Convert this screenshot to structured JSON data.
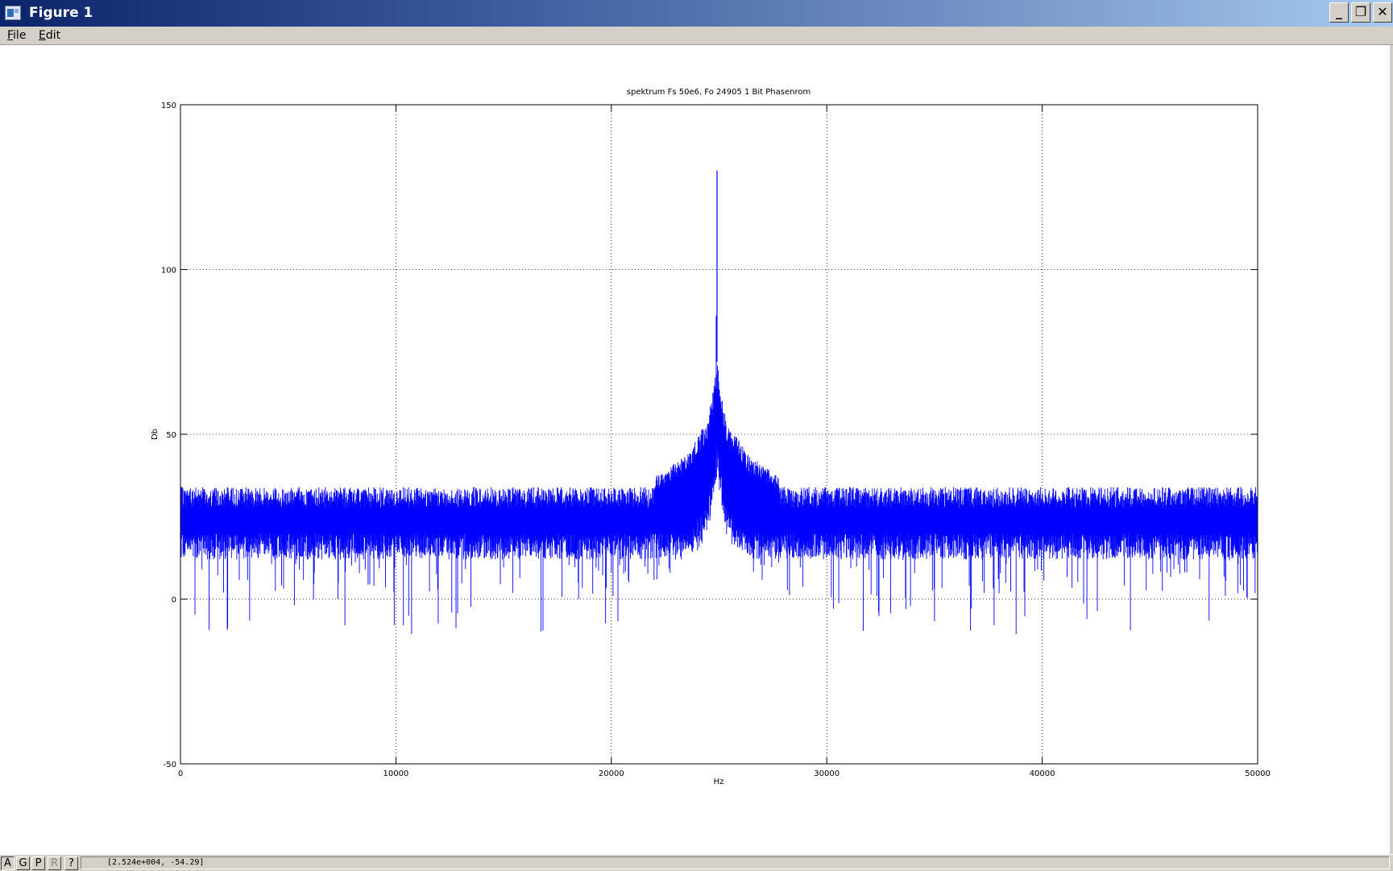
{
  "window": {
    "title": "Figure 1",
    "minimize_symbol": "_",
    "maximize_symbol": "❐",
    "close_symbol": "✕"
  },
  "menu": {
    "items": [
      {
        "label": "File",
        "accel": "F",
        "rest": "ile"
      },
      {
        "label": "Edit",
        "accel": "E",
        "rest": "dit"
      }
    ]
  },
  "colors": {
    "trace": "#0000ff",
    "titlebar_start": "#0c246a",
    "titlebar_end": "#a6caf0"
  },
  "status": {
    "buttons": [
      {
        "label": "A",
        "name": "autoscale-button"
      },
      {
        "label": "G",
        "name": "grid-button"
      },
      {
        "label": "P",
        "name": "pan-button"
      },
      {
        "label": "R",
        "name": "rotate-button"
      },
      {
        "label": "?",
        "name": "help-button"
      }
    ],
    "coords": "[2.524e+004, -54.29]"
  },
  "chart_data": {
    "type": "line",
    "title": "spektrum Fs 50e6, Fo 24905 1 Bit Phasenrom",
    "xlabel": "Hz",
    "ylabel": "Db",
    "xlim": [
      0,
      50000
    ],
    "ylim": [
      -50,
      150
    ],
    "xticks": [
      0,
      10000,
      20000,
      30000,
      40000,
      50000
    ],
    "yticks": [
      -50,
      0,
      50,
      100,
      150
    ],
    "grid": true,
    "series": [
      {
        "noise_floor_db": [
          20,
          34
        ],
        "noise_minimum_db": [
          -11,
          0
        ],
        "peak": {
          "x": 24905,
          "y": 130
        },
        "skirt": [
          {
            "x": 22000,
            "y": 37
          },
          {
            "x": 23500,
            "y": 44
          },
          {
            "x": 24500,
            "y": 55
          },
          {
            "x": 24905,
            "y": 72
          },
          {
            "x": 25300,
            "y": 55
          },
          {
            "x": 26300,
            "y": 44
          },
          {
            "x": 27800,
            "y": 37
          }
        ]
      }
    ]
  }
}
